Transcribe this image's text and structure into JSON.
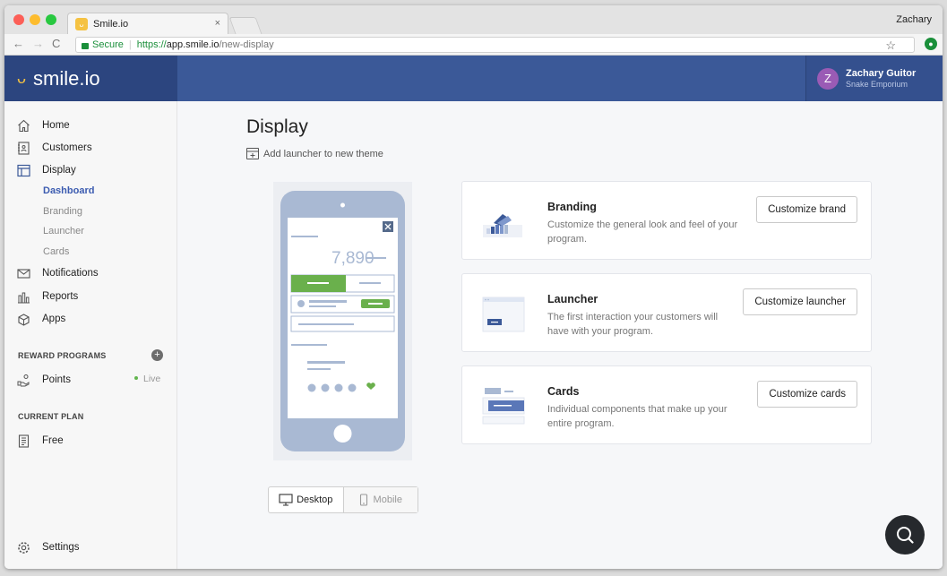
{
  "browser": {
    "tab_title": "Smile.io",
    "tab_close": "×",
    "profile_name": "Zachary",
    "secure_label": "Secure",
    "url_scheme": "https://",
    "url_host": "app.smile.io",
    "url_path": "/new-display",
    "favicon_glyph": "ᴗ"
  },
  "header": {
    "logo_text": "smile.io",
    "user_initial": "Z",
    "user_name": "Zachary Guitor",
    "store_name": "Snake Emporium"
  },
  "sidebar": {
    "items": [
      {
        "label": "Home",
        "icon": "home-icon"
      },
      {
        "label": "Customers",
        "icon": "customers-icon"
      },
      {
        "label": "Display",
        "icon": "display-icon"
      }
    ],
    "display_sub": [
      {
        "label": "Dashboard",
        "active": true
      },
      {
        "label": "Branding",
        "active": false
      },
      {
        "label": "Launcher",
        "active": false
      },
      {
        "label": "Cards",
        "active": false
      }
    ],
    "items2": [
      {
        "label": "Notifications",
        "icon": "envelope-icon"
      },
      {
        "label": "Reports",
        "icon": "reports-icon"
      },
      {
        "label": "Apps",
        "icon": "apps-icon"
      }
    ],
    "reward_programs_heading": "REWARD PROGRAMS",
    "add_glyph": "+",
    "points_label": "Points",
    "points_status": "Live",
    "current_plan_heading": "CURRENT PLAN",
    "plan_label": "Free",
    "settings_label": "Settings"
  },
  "main": {
    "title": "Display",
    "add_launcher_label": "Add launcher to new theme",
    "phone_preview": {
      "points_value": "7,890"
    },
    "cards": [
      {
        "title": "Branding",
        "description": "Customize the general look and feel of your program.",
        "button": "Customize brand"
      },
      {
        "title": "Launcher",
        "description": "The first interaction your customers will have with your program.",
        "button": "Customize launcher"
      },
      {
        "title": "Cards",
        "description": "Individual components that make up your entire program.",
        "button": "Customize cards"
      }
    ],
    "view_toggle": {
      "desktop_label": "Desktop",
      "mobile_label": "Mobile",
      "selected": "Desktop"
    }
  },
  "colors": {
    "header_blue": "#3b5998",
    "logo_panel": "#2c457f",
    "brand_yellow": "#f5c242",
    "accent_green": "#62b54e",
    "active_link": "#3b5bb0",
    "avatar_purple": "#9a5bb5"
  }
}
